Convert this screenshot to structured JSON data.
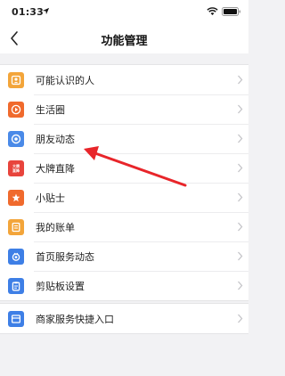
{
  "status_bar": {
    "time": "01:33"
  },
  "nav": {
    "title": "功能管理"
  },
  "menu": [
    {
      "label": "可能认识的人",
      "icon": "person-card-icon",
      "color": "#f3a53a"
    },
    {
      "label": "生活圈",
      "icon": "play-circle-icon",
      "color": "#f06a2d"
    },
    {
      "label": "朋友动态",
      "icon": "camera-aperture-icon",
      "color": "#4a8ae8"
    },
    {
      "label": "大牌直降",
      "icon": "brand-discount-icon",
      "icon_text": "大牌\n直降",
      "color": "#e8443c"
    },
    {
      "label": "小贴士",
      "icon": "star-tip-icon",
      "color": "#f06a2d"
    },
    {
      "label": "我的账单",
      "icon": "bill-icon",
      "color": "#f3a53a"
    },
    {
      "label": "首页服务动态",
      "icon": "service-icon",
      "color": "#3e7fe6"
    },
    {
      "label": "剪贴板设置",
      "icon": "clipboard-icon",
      "color": "#3e7fe6"
    }
  ],
  "menu2": [
    {
      "label": "商家服务快捷入口",
      "icon": "merchant-shortcut-icon",
      "color": "#3e7fe6"
    }
  ],
  "annotation": {
    "arrow_color": "#e8252a"
  }
}
